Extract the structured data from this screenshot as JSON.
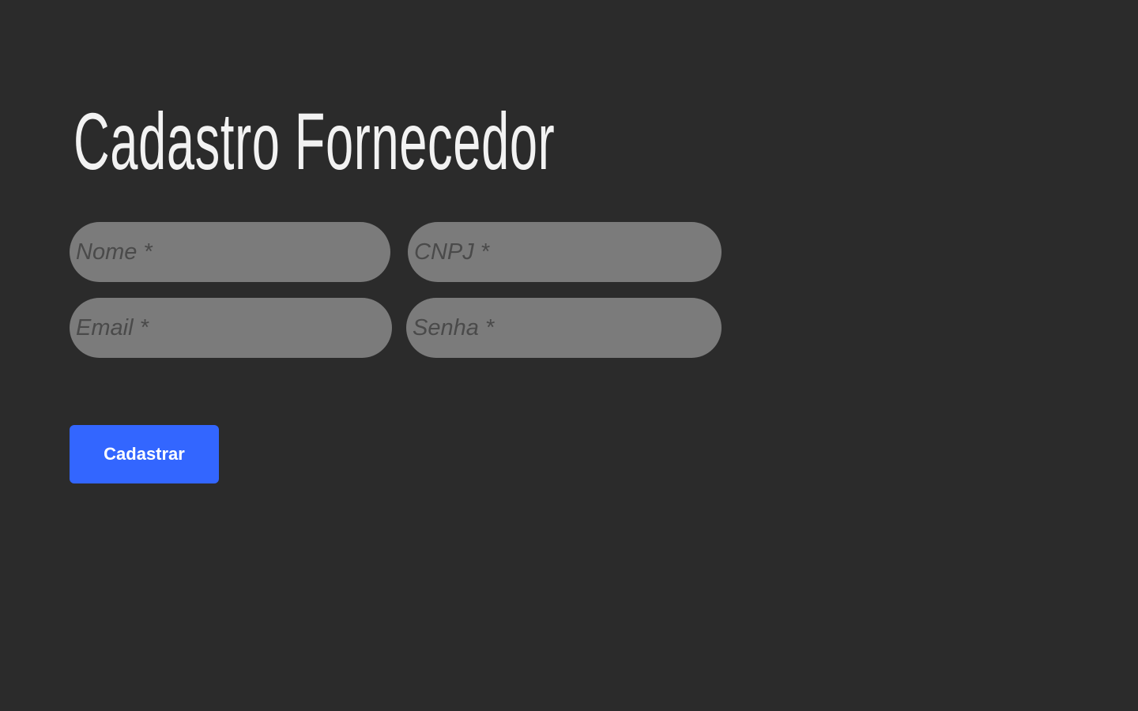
{
  "page": {
    "title": "Cadastro Fornecedor"
  },
  "form": {
    "fields": [
      {
        "placeholder": "Nome *",
        "value": ""
      },
      {
        "placeholder": "CNPJ *",
        "value": ""
      },
      {
        "placeholder": "Email *",
        "value": ""
      },
      {
        "placeholder": "Senha *",
        "value": ""
      }
    ],
    "submit_label": "Cadastrar"
  },
  "colors": {
    "background": "#2b2b2b",
    "field_background": "#7b7b7b",
    "accent": "#3366ff",
    "title": "#f2f2f2"
  }
}
